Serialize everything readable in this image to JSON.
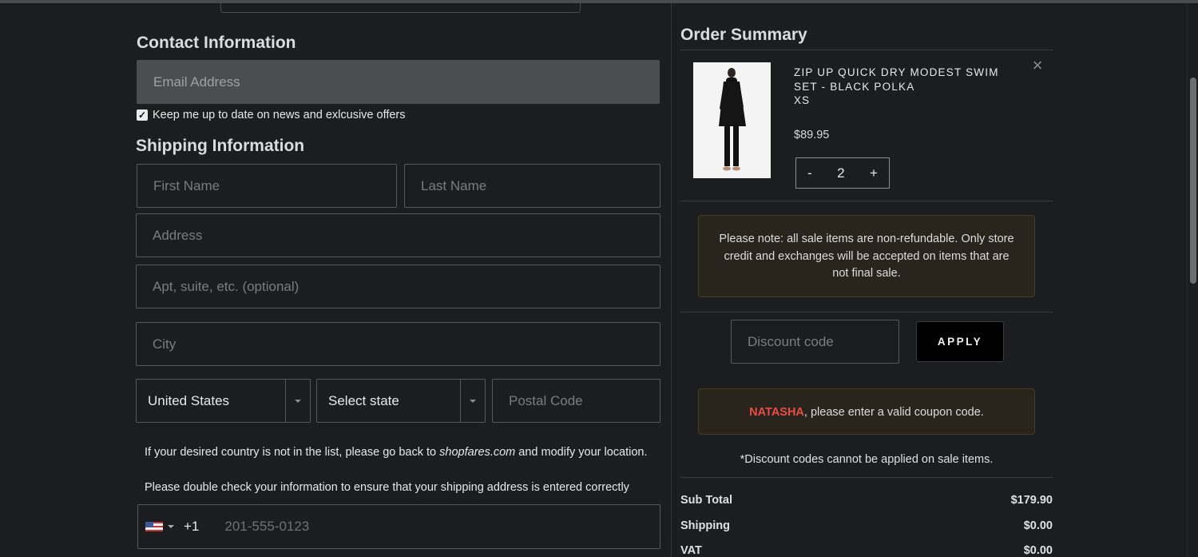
{
  "contact": {
    "title": "Contact Information",
    "email_placeholder": "Email Address",
    "newsletter_label": "Keep me up to date on news and exlcusive offers",
    "newsletter_checked": true
  },
  "shipping": {
    "title": "Shipping Information",
    "first_name_placeholder": "First Name",
    "last_name_placeholder": "Last Name",
    "address_placeholder": "Address",
    "apt_placeholder": "Apt, suite, etc. (optional)",
    "city_placeholder": "City",
    "country_value": "United States",
    "state_value": "Select state",
    "postal_placeholder": "Postal Code",
    "country_note_before": "If your desired country is not in the list, please go back to ",
    "country_note_link": "shopfares.com",
    "country_note_after": " and modify your location.",
    "double_check_note": "Please double check your information to ensure that your shipping address is entered correctly",
    "phone_country_code": "+1",
    "phone_placeholder": "201-555-0123",
    "phone_flag": "us-flag-icon"
  },
  "order_summary": {
    "title": "Order Summary",
    "item": {
      "name": "ZIP UP QUICK DRY MODEST SWIM SET - BLACK POLKA",
      "size": "XS",
      "price": "$89.95",
      "quantity": "2",
      "minus_label": "-",
      "plus_label": "+",
      "remove_icon": "close-icon"
    },
    "sale_notice": "Please note: all sale items are non-refundable. Only store credit and exchanges will be accepted on items that are not final sale.",
    "discount_placeholder": "Discount code",
    "apply_label": "APPLY",
    "coupon_error_name": "NATASHA",
    "coupon_error_text": ", please enter a valid coupon code.",
    "discount_note": "*Discount codes cannot be applied on sale items.",
    "totals": [
      {
        "label": "Sub Total",
        "value": "$179.90"
      },
      {
        "label": "Shipping",
        "value": "$0.00"
      },
      {
        "label": "VAT",
        "value": "$0.00"
      }
    ]
  },
  "colors": {
    "background": "#1c1d1f",
    "error_name": "#e84b4b",
    "notice_bg": "#2a251c"
  }
}
